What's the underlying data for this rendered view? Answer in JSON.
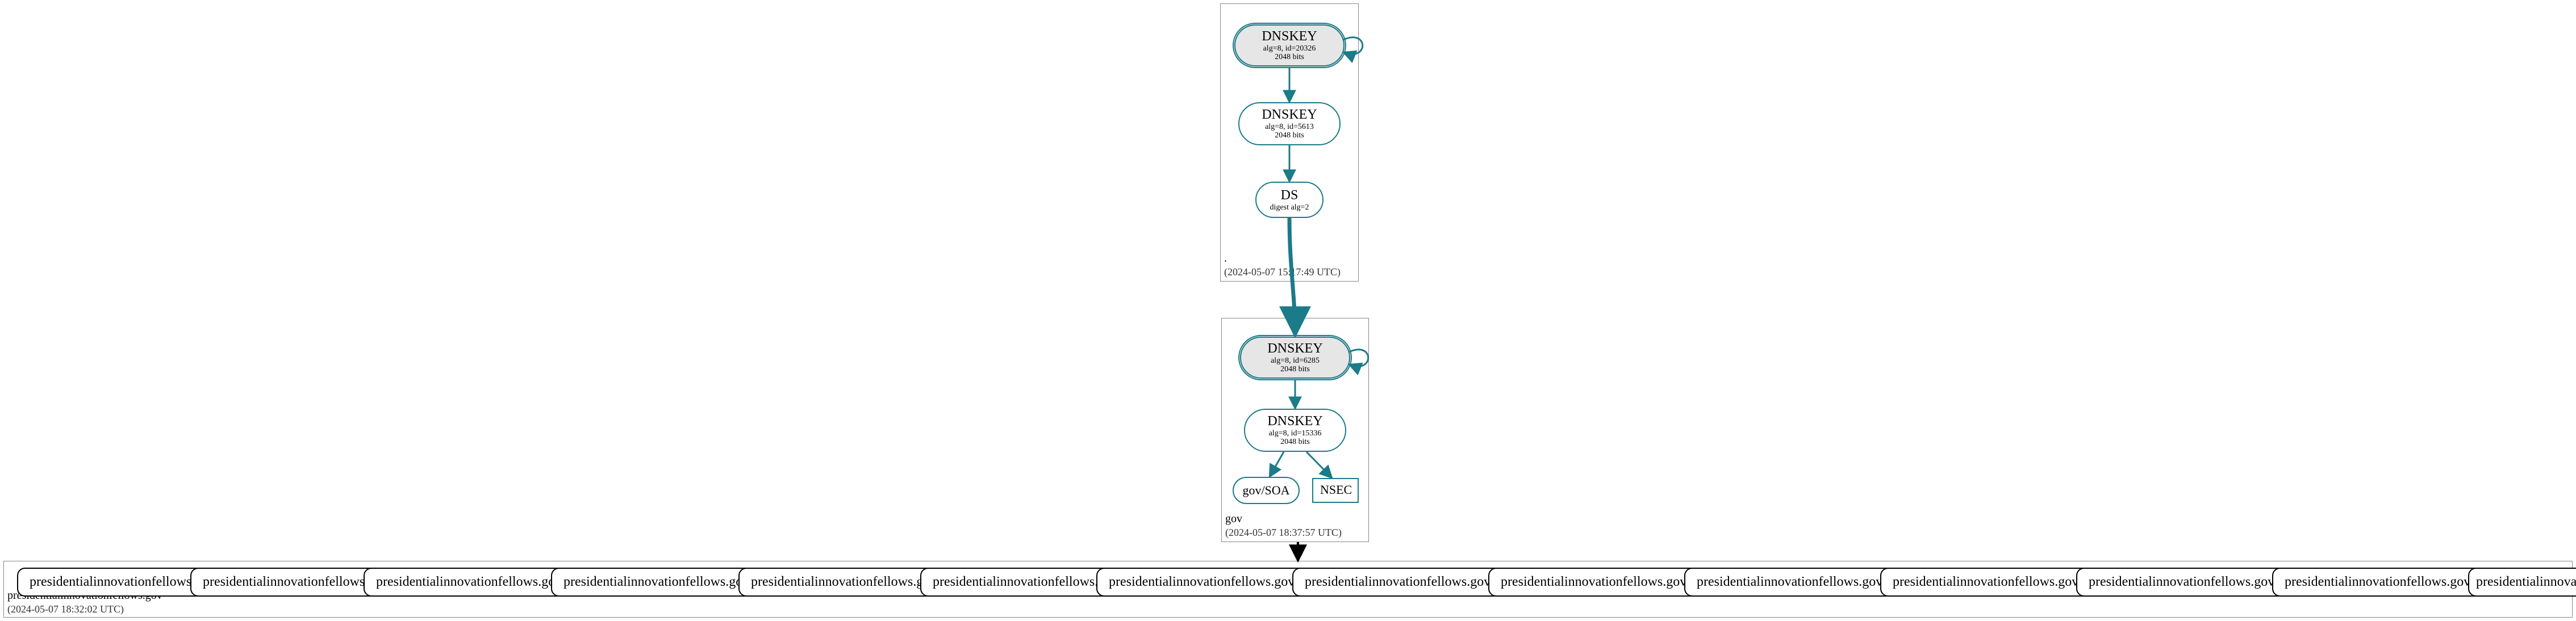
{
  "root_zone": {
    "label": ".",
    "timestamp": "(2024-05-07 15:17:49 UTC)",
    "ksk": {
      "title": "DNSKEY",
      "line2": "alg=8, id=20326",
      "line3": "2048 bits"
    },
    "zsk": {
      "title": "DNSKEY",
      "line2": "alg=8, id=5613",
      "line3": "2048 bits"
    },
    "ds": {
      "title": "DS",
      "line2": "digest alg=2"
    }
  },
  "gov_zone": {
    "label": "gov",
    "timestamp": "(2024-05-07 18:37:57 UTC)",
    "ksk": {
      "title": "DNSKEY",
      "line2": "alg=8, id=6285",
      "line3": "2048 bits"
    },
    "zsk": {
      "title": "DNSKEY",
      "line2": "alg=8, id=15336",
      "line3": "2048 bits"
    },
    "soa": {
      "title": "gov/SOA"
    },
    "nsec": {
      "title": "NSEC"
    }
  },
  "pif_zone": {
    "label": "presidentialinnovationfellows.gov",
    "timestamp": "(2024-05-07 18:32:02 UTC)",
    "records": [
      "presidentialinnovationfellows.gov/A",
      "presidentialinnovationfellows.gov/A",
      "presidentialinnovationfellows.gov/SOA",
      "presidentialinnovationfellows.gov/TXT",
      "presidentialinnovationfellows.gov/MX",
      "presidentialinnovationfellows.gov/NS",
      "presidentialinnovationfellows.gov/AAAA",
      "presidentialinnovationfellows.gov/AAAA",
      "presidentialinnovationfellows.gov/AAAA",
      "presidentialinnovationfellows.gov/AAAA",
      "presidentialinnovationfellows.gov/AAAA",
      "presidentialinnovationfellows.gov/AAAA",
      "presidentialinnovationfellows.gov/AAAA",
      "presidentialinnovationfellows.gov/AAAA"
    ]
  }
}
